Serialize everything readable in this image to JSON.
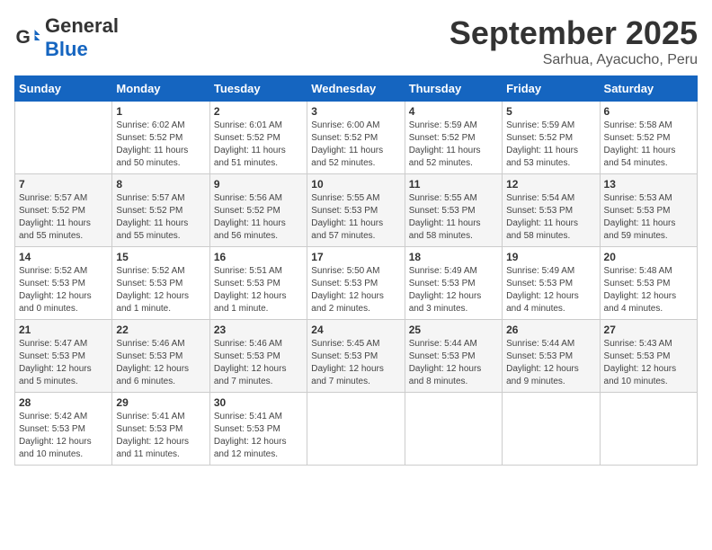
{
  "header": {
    "logo_general": "General",
    "logo_blue": "Blue",
    "month_title": "September 2025",
    "subtitle": "Sarhua, Ayacucho, Peru"
  },
  "days_of_week": [
    "Sunday",
    "Monday",
    "Tuesday",
    "Wednesday",
    "Thursday",
    "Friday",
    "Saturday"
  ],
  "weeks": [
    [
      {
        "day": "",
        "info": ""
      },
      {
        "day": "1",
        "info": "Sunrise: 6:02 AM\nSunset: 5:52 PM\nDaylight: 11 hours\nand 50 minutes."
      },
      {
        "day": "2",
        "info": "Sunrise: 6:01 AM\nSunset: 5:52 PM\nDaylight: 11 hours\nand 51 minutes."
      },
      {
        "day": "3",
        "info": "Sunrise: 6:00 AM\nSunset: 5:52 PM\nDaylight: 11 hours\nand 52 minutes."
      },
      {
        "day": "4",
        "info": "Sunrise: 5:59 AM\nSunset: 5:52 PM\nDaylight: 11 hours\nand 52 minutes."
      },
      {
        "day": "5",
        "info": "Sunrise: 5:59 AM\nSunset: 5:52 PM\nDaylight: 11 hours\nand 53 minutes."
      },
      {
        "day": "6",
        "info": "Sunrise: 5:58 AM\nSunset: 5:52 PM\nDaylight: 11 hours\nand 54 minutes."
      }
    ],
    [
      {
        "day": "7",
        "info": "Sunrise: 5:57 AM\nSunset: 5:52 PM\nDaylight: 11 hours\nand 55 minutes."
      },
      {
        "day": "8",
        "info": "Sunrise: 5:57 AM\nSunset: 5:52 PM\nDaylight: 11 hours\nand 55 minutes."
      },
      {
        "day": "9",
        "info": "Sunrise: 5:56 AM\nSunset: 5:52 PM\nDaylight: 11 hours\nand 56 minutes."
      },
      {
        "day": "10",
        "info": "Sunrise: 5:55 AM\nSunset: 5:53 PM\nDaylight: 11 hours\nand 57 minutes."
      },
      {
        "day": "11",
        "info": "Sunrise: 5:55 AM\nSunset: 5:53 PM\nDaylight: 11 hours\nand 58 minutes."
      },
      {
        "day": "12",
        "info": "Sunrise: 5:54 AM\nSunset: 5:53 PM\nDaylight: 11 hours\nand 58 minutes."
      },
      {
        "day": "13",
        "info": "Sunrise: 5:53 AM\nSunset: 5:53 PM\nDaylight: 11 hours\nand 59 minutes."
      }
    ],
    [
      {
        "day": "14",
        "info": "Sunrise: 5:52 AM\nSunset: 5:53 PM\nDaylight: 12 hours\nand 0 minutes."
      },
      {
        "day": "15",
        "info": "Sunrise: 5:52 AM\nSunset: 5:53 PM\nDaylight: 12 hours\nand 1 minute."
      },
      {
        "day": "16",
        "info": "Sunrise: 5:51 AM\nSunset: 5:53 PM\nDaylight: 12 hours\nand 1 minute."
      },
      {
        "day": "17",
        "info": "Sunrise: 5:50 AM\nSunset: 5:53 PM\nDaylight: 12 hours\nand 2 minutes."
      },
      {
        "day": "18",
        "info": "Sunrise: 5:49 AM\nSunset: 5:53 PM\nDaylight: 12 hours\nand 3 minutes."
      },
      {
        "day": "19",
        "info": "Sunrise: 5:49 AM\nSunset: 5:53 PM\nDaylight: 12 hours\nand 4 minutes."
      },
      {
        "day": "20",
        "info": "Sunrise: 5:48 AM\nSunset: 5:53 PM\nDaylight: 12 hours\nand 4 minutes."
      }
    ],
    [
      {
        "day": "21",
        "info": "Sunrise: 5:47 AM\nSunset: 5:53 PM\nDaylight: 12 hours\nand 5 minutes."
      },
      {
        "day": "22",
        "info": "Sunrise: 5:46 AM\nSunset: 5:53 PM\nDaylight: 12 hours\nand 6 minutes."
      },
      {
        "day": "23",
        "info": "Sunrise: 5:46 AM\nSunset: 5:53 PM\nDaylight: 12 hours\nand 7 minutes."
      },
      {
        "day": "24",
        "info": "Sunrise: 5:45 AM\nSunset: 5:53 PM\nDaylight: 12 hours\nand 7 minutes."
      },
      {
        "day": "25",
        "info": "Sunrise: 5:44 AM\nSunset: 5:53 PM\nDaylight: 12 hours\nand 8 minutes."
      },
      {
        "day": "26",
        "info": "Sunrise: 5:44 AM\nSunset: 5:53 PM\nDaylight: 12 hours\nand 9 minutes."
      },
      {
        "day": "27",
        "info": "Sunrise: 5:43 AM\nSunset: 5:53 PM\nDaylight: 12 hours\nand 10 minutes."
      }
    ],
    [
      {
        "day": "28",
        "info": "Sunrise: 5:42 AM\nSunset: 5:53 PM\nDaylight: 12 hours\nand 10 minutes."
      },
      {
        "day": "29",
        "info": "Sunrise: 5:41 AM\nSunset: 5:53 PM\nDaylight: 12 hours\nand 11 minutes."
      },
      {
        "day": "30",
        "info": "Sunrise: 5:41 AM\nSunset: 5:53 PM\nDaylight: 12 hours\nand 12 minutes."
      },
      {
        "day": "",
        "info": ""
      },
      {
        "day": "",
        "info": ""
      },
      {
        "day": "",
        "info": ""
      },
      {
        "day": "",
        "info": ""
      }
    ]
  ]
}
